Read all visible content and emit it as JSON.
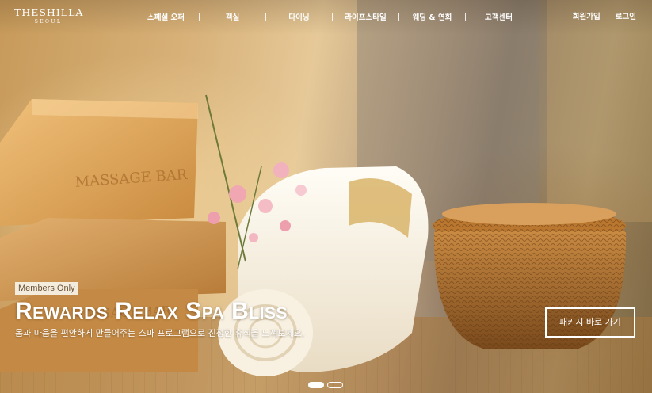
{
  "logo": {
    "main": "THESHILLA",
    "sub": "SEOUL"
  },
  "nav": {
    "items": [
      {
        "label": "스페셜 오퍼"
      },
      {
        "label": "객실"
      },
      {
        "label": "다이닝"
      },
      {
        "label": "라이프스타일"
      },
      {
        "label": "웨딩 & 연회"
      },
      {
        "label": "고객센터"
      }
    ]
  },
  "utility": {
    "signup": "회원가입",
    "login": "로그인"
  },
  "hero": {
    "badge": "Members Only",
    "headline": "Rewards Relax Spa Bliss",
    "subline": "몸과 마음을 편안하게 만들어주는 스파 프로그램으로 진정한 휴식을 느껴보세요.",
    "cta": "패키지 바로 가기",
    "image_text": {
      "soap_label": "MASSAGE BAR"
    }
  },
  "carousel": {
    "slides": 2,
    "active_index": 0
  }
}
